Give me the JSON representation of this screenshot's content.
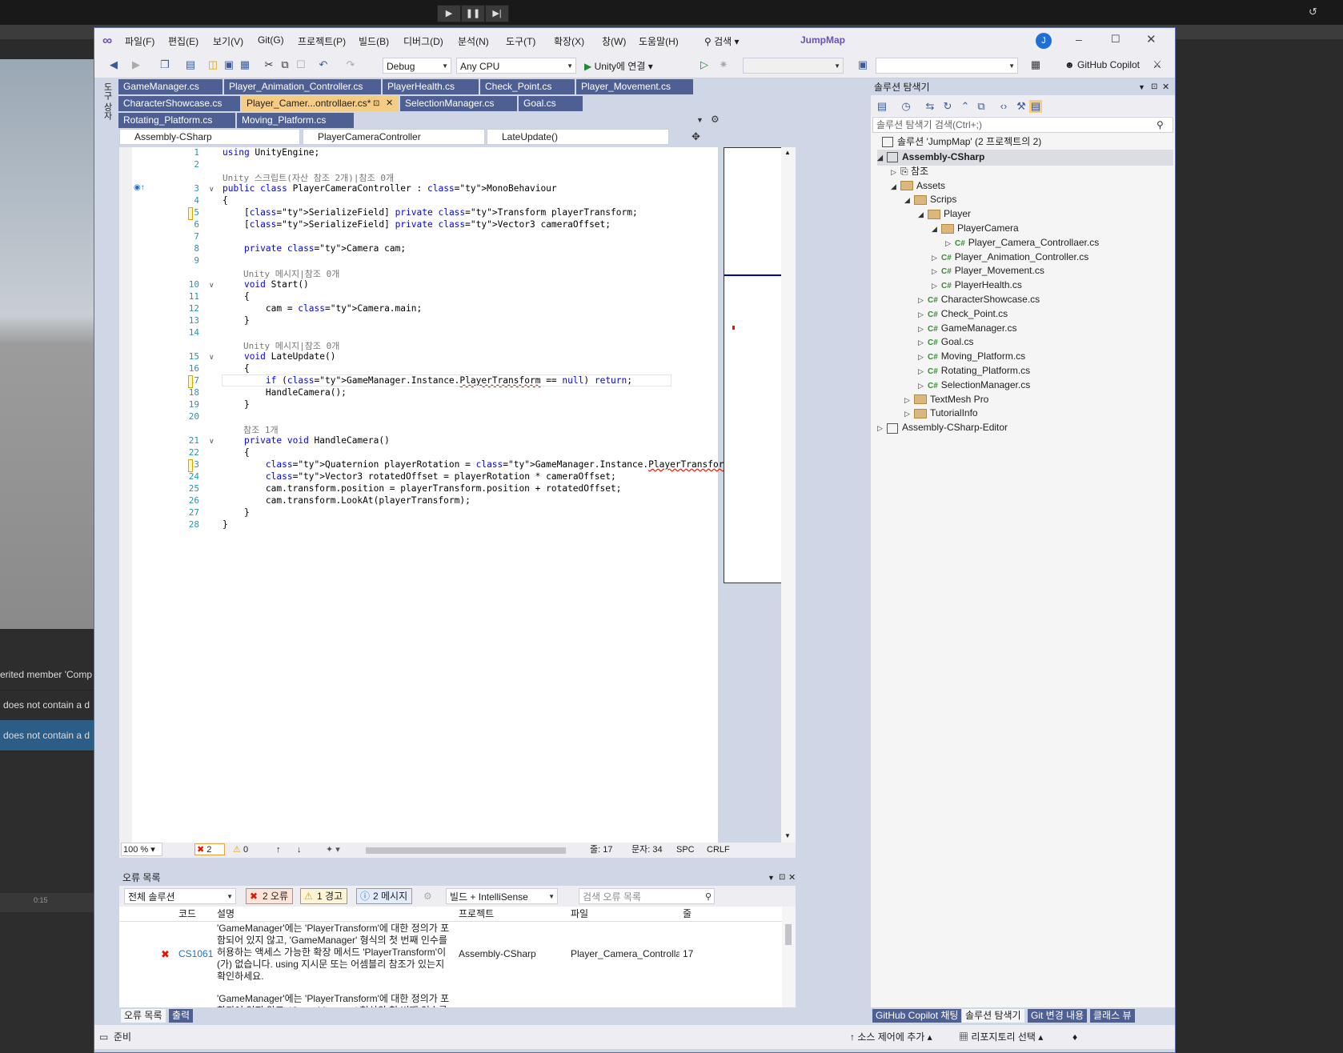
{
  "unity": {
    "messages": [
      "erited member 'Comp",
      "does not contain a d",
      "does not contain a d"
    ],
    "timeline_marker": "0:15"
  },
  "vs": {
    "app_title": "JumpMap",
    "account_initial": "J",
    "menu": [
      "파일(F)",
      "편집(E)",
      "보기(V)",
      "Git(G)",
      "프로젝트(P)",
      "빌드(B)",
      "디버그(D)",
      "분석(N)",
      "도구(T)",
      "확장(X)",
      "창(W)",
      "도움말(H)"
    ],
    "search_label": "검색",
    "toolbar": {
      "config": "Debug",
      "platform": "Any CPU",
      "run_label": "Unity에 연결",
      "copilot_label": "GitHub Copilot"
    },
    "side_strip_label": "도구 상자",
    "doc_tabs_row1": [
      "GameManager.cs",
      "Player_Animation_Controller.cs",
      "PlayerHealth.cs",
      "Check_Point.cs",
      "Player_Movement.cs"
    ],
    "doc_tabs_row2": [
      "CharacterShowcase.cs",
      "Player_Camer...ontrollaer.cs*",
      "SelectionManager.cs",
      "Goal.cs"
    ],
    "doc_tabs_row3": [
      "Rotating_Platform.cs",
      "Moving_Platform.cs"
    ],
    "nav": {
      "project": "Assembly-CSharp",
      "class": "PlayerCameraController",
      "member": "LateUpdate()"
    },
    "code_lines": [
      "using UnityEngine;",
      "",
      "public class PlayerCameraController : MonoBehaviour",
      "{",
      "    [SerializeField] private Transform playerTransform;",
      "    [SerializeField] private Vector3 cameraOffset;",
      "",
      "    private Camera cam;",
      "",
      "    void Start()",
      "    {",
      "        cam = Camera.main;",
      "    }",
      "",
      "    void LateUpdate()",
      "    {",
      "        if (GameManager.Instance.PlayerTransform == null) return;",
      "        HandleCamera();",
      "    }",
      "",
      "    private void HandleCamera()",
      "    {",
      "        Quaternion playerRotation = GameManager.Instance.PlayerTransform.rotation;",
      "        Vector3 rotatedOffset = playerRotation * cameraOffset;",
      "        cam.transform.position = playerTransform.position + rotatedOffset;",
      "        cam.transform.LookAt(playerTransform);",
      "    }",
      "}"
    ],
    "codelens": {
      "class": "Unity 스크립트(자산 참조 2개)|참조 0개",
      "start": "Unity 메시지|참조 0개",
      "lateupdate": "Unity 메시지|참조 0개",
      "handle": "참조 1개"
    },
    "editor_status": {
      "zoom": "100 %",
      "errors": "2",
      "warnings": "0",
      "line": "줄: 17",
      "col": "문자: 34",
      "spc": "SPC",
      "eol": "CRLF"
    },
    "error_list": {
      "title": "오류 목록",
      "scope": "전체 솔루션",
      "errors_btn": "2 오류",
      "warnings_btn": "1 경고",
      "messages_btn": "2 메시지",
      "source": "빌드 + IntelliSense",
      "search_placeholder": "검색 오류 목록",
      "columns": [
        "코드",
        "설명",
        "프로젝트",
        "파일",
        "줄"
      ],
      "rows": [
        {
          "code": "CS1061",
          "desc": "'GameManager'에는 'PlayerTransform'에 대한 정의가 포함되어 있지 않고, 'GameManager' 형식의 첫 번째 인수를 허용하는 액세스 가능한 확장 메서드 'PlayerTransform'이(가) 없습니다. using 지시문 또는 어셈블리 참조가 있는지 확인하세요.",
          "project": "Assembly-CSharp",
          "file": "Player_Camera_Controllae...",
          "line": "17"
        },
        {
          "code": "",
          "desc": "'GameManager'에는 'PlayerTransform'에 대한 정의가 포함되어 있지 않고, 'GameManager' 형식의 첫 번째 인수를 허",
          "project": "",
          "file": "",
          "line": ""
        }
      ],
      "bottom_tabs": [
        "오류 목록",
        "출력"
      ]
    },
    "solution_explorer": {
      "title": "솔루션 탐색기",
      "search_placeholder": "솔루션 탐색기 검색(Ctrl+;)",
      "solution_label": "솔루션 'JumpMap'  (2 프로젝트의 2)",
      "tree": [
        {
          "label": "Assembly-CSharp",
          "depth": 0,
          "kind": "project",
          "exp": "open"
        },
        {
          "label": "참조",
          "depth": 1,
          "kind": "ref",
          "exp": "closed"
        },
        {
          "label": "Assets",
          "depth": 1,
          "kind": "folder",
          "exp": "open"
        },
        {
          "label": "Scrips",
          "depth": 2,
          "kind": "folder",
          "exp": "open"
        },
        {
          "label": "Player",
          "depth": 3,
          "kind": "folder",
          "exp": "open"
        },
        {
          "label": "PlayerCamera",
          "depth": 4,
          "kind": "folder",
          "exp": "open"
        },
        {
          "label": "Player_Camera_Controllaer.cs",
          "depth": 5,
          "kind": "cs",
          "exp": "closed"
        },
        {
          "label": "Player_Animation_Controller.cs",
          "depth": 4,
          "kind": "cs",
          "exp": "closed"
        },
        {
          "label": "Player_Movement.cs",
          "depth": 4,
          "kind": "cs",
          "exp": "closed"
        },
        {
          "label": "PlayerHealth.cs",
          "depth": 4,
          "kind": "cs",
          "exp": "closed"
        },
        {
          "label": "CharacterShowcase.cs",
          "depth": 3,
          "kind": "cs",
          "exp": "closed"
        },
        {
          "label": "Check_Point.cs",
          "depth": 3,
          "kind": "cs",
          "exp": "closed"
        },
        {
          "label": "GameManager.cs",
          "depth": 3,
          "kind": "cs",
          "exp": "closed"
        },
        {
          "label": "Goal.cs",
          "depth": 3,
          "kind": "cs",
          "exp": "closed"
        },
        {
          "label": "Moving_Platform.cs",
          "depth": 3,
          "kind": "cs",
          "exp": "closed"
        },
        {
          "label": "Rotating_Platform.cs",
          "depth": 3,
          "kind": "cs",
          "exp": "closed"
        },
        {
          "label": "SelectionManager.cs",
          "depth": 3,
          "kind": "cs",
          "exp": "closed"
        },
        {
          "label": "TextMesh Pro",
          "depth": 2,
          "kind": "folder",
          "exp": "closed"
        },
        {
          "label": "TutorialInfo",
          "depth": 2,
          "kind": "folder",
          "exp": "closed"
        },
        {
          "label": "Assembly-CSharp-Editor",
          "depth": 0,
          "kind": "project",
          "exp": "closed"
        }
      ],
      "bottom_tabs": [
        "GitHub Copilot 채팅",
        "솔루션 탐색기",
        "Git 변경 내용",
        "클래스 뷰"
      ]
    },
    "statusbar": {
      "ready": "준비",
      "source_control": "소스 제어에 추가",
      "repo": "리포지토리 선택"
    }
  }
}
